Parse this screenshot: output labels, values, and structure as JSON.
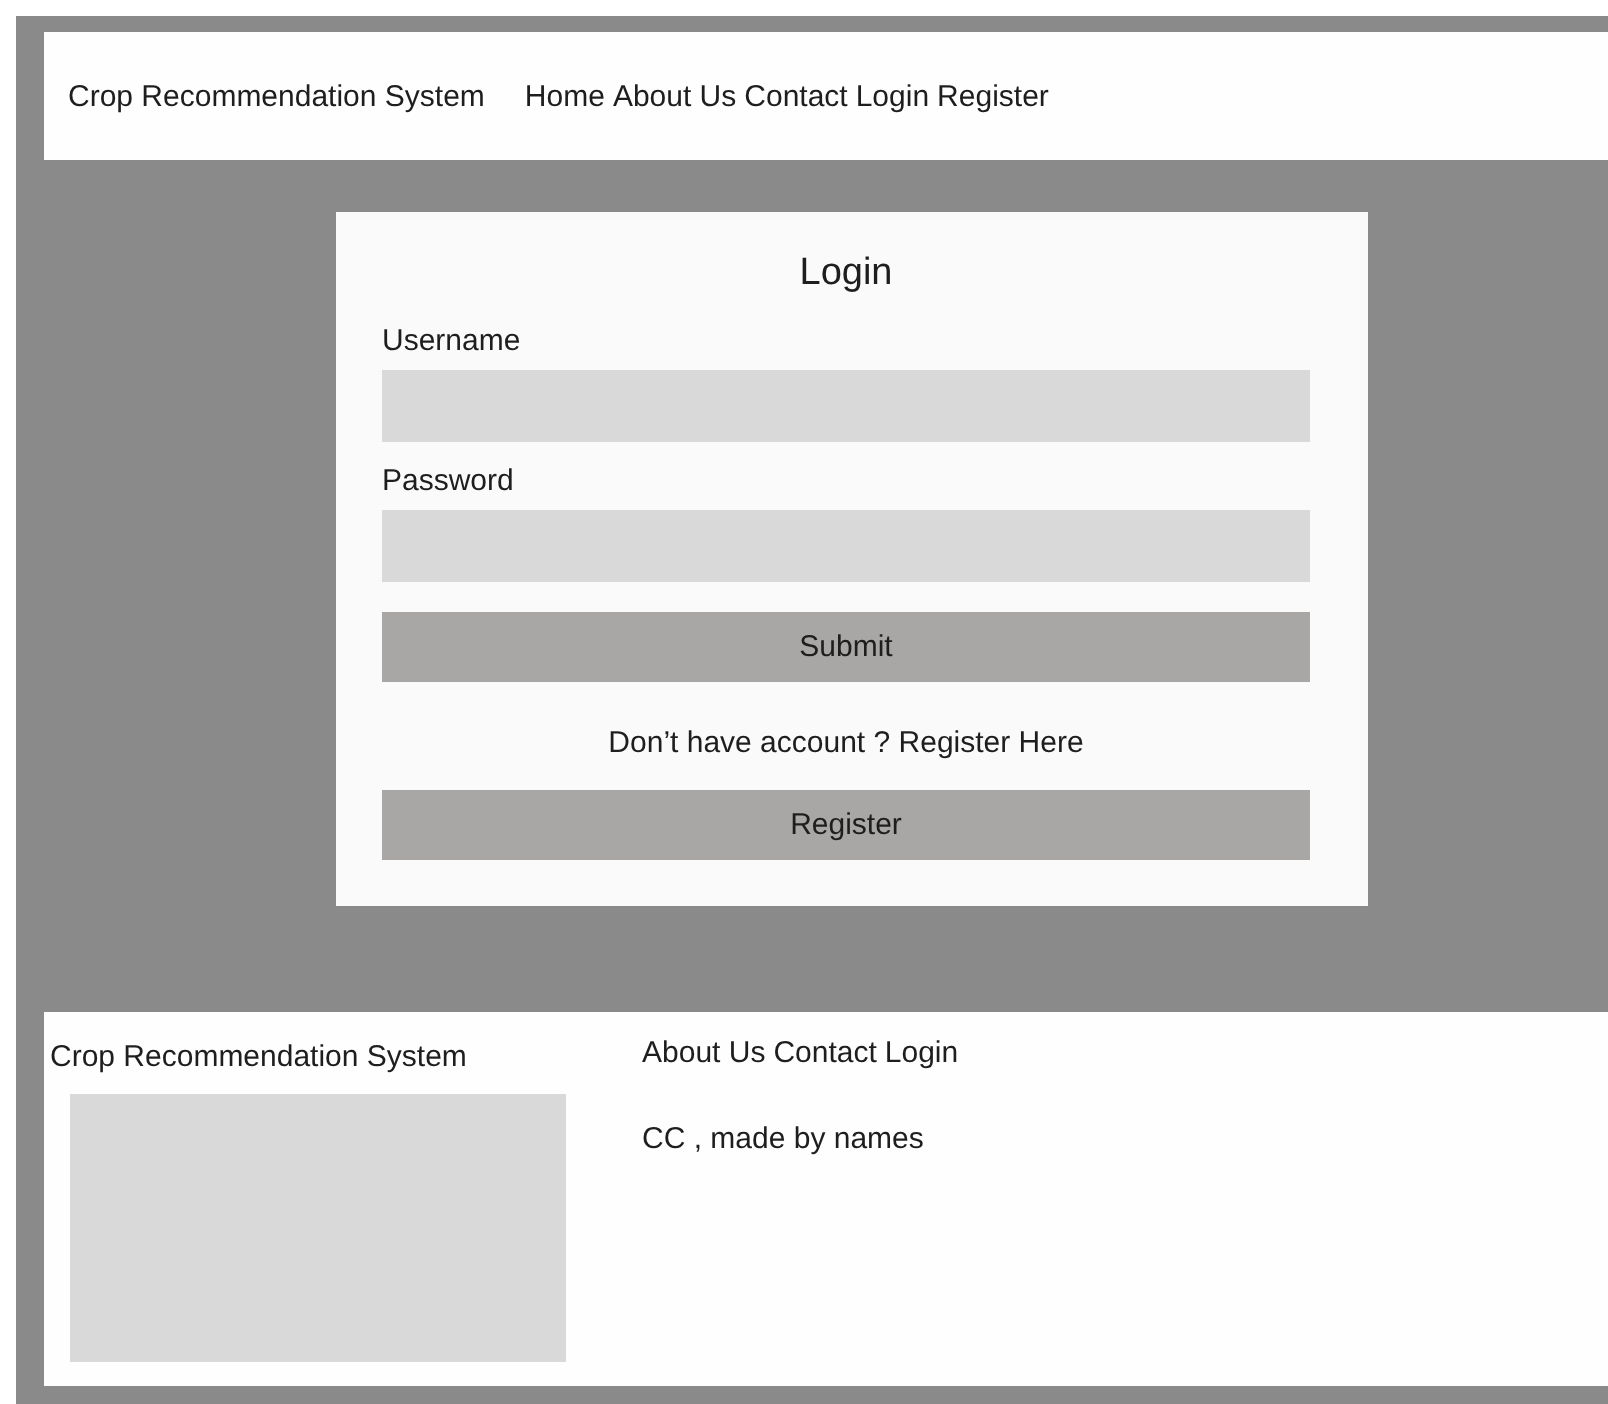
{
  "header": {
    "brand": "Crop Recommendation System",
    "nav": [
      "Home",
      "About Us",
      "Contact",
      "Login",
      "Register"
    ]
  },
  "login": {
    "title": "Login",
    "fields": [
      {
        "label": "Username"
      },
      {
        "label": "Password"
      }
    ],
    "submit": "Submit",
    "prompt": "Don’t have account ? Register Here",
    "register": "Register"
  },
  "footer": {
    "brand": "Crop Recommendation System",
    "links": [
      "About Us",
      "Contact",
      "Login"
    ],
    "note": "CC , made by names"
  }
}
